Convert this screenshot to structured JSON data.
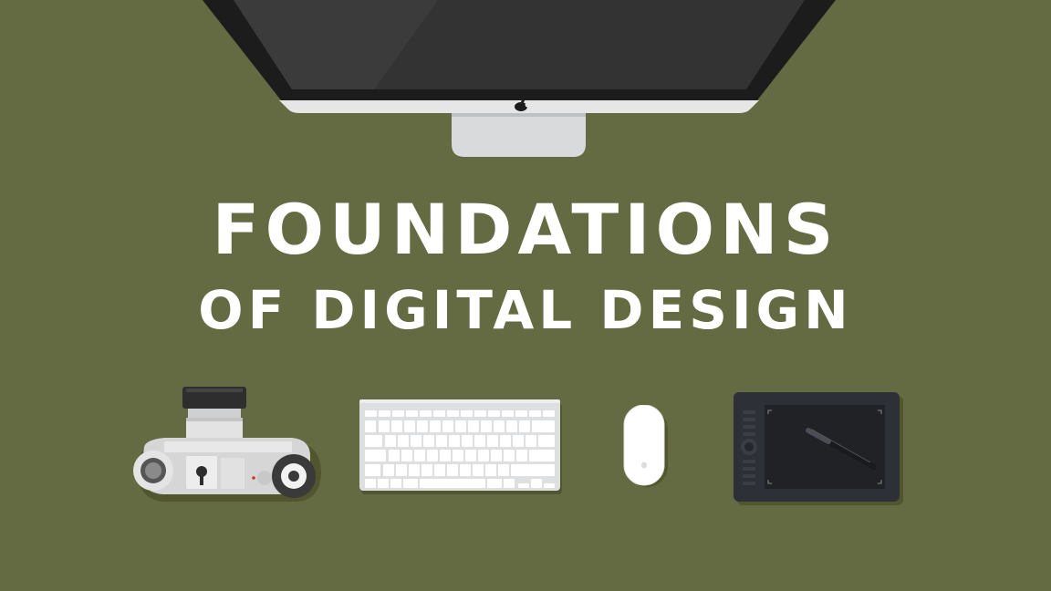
{
  "title": {
    "line1": "FOUNDATIONS",
    "line2": "OF DIGITAL DESIGN"
  },
  "colors": {
    "background": "#646a42",
    "title_text": "#ffffff",
    "monitor_bezel": "#1c1c1c",
    "monitor_screen": "#333333",
    "device_silver": "#e6e6e6",
    "tablet_body": "#2d3036"
  },
  "icons": {
    "monitor": "imac-monitor-icon",
    "logo": "apple-logo-icon",
    "camera": "film-camera-icon",
    "keyboard": "keyboard-icon",
    "mouse": "magic-mouse-icon",
    "tablet": "drawing-tablet-icon",
    "pen": "stylus-pen-icon"
  }
}
